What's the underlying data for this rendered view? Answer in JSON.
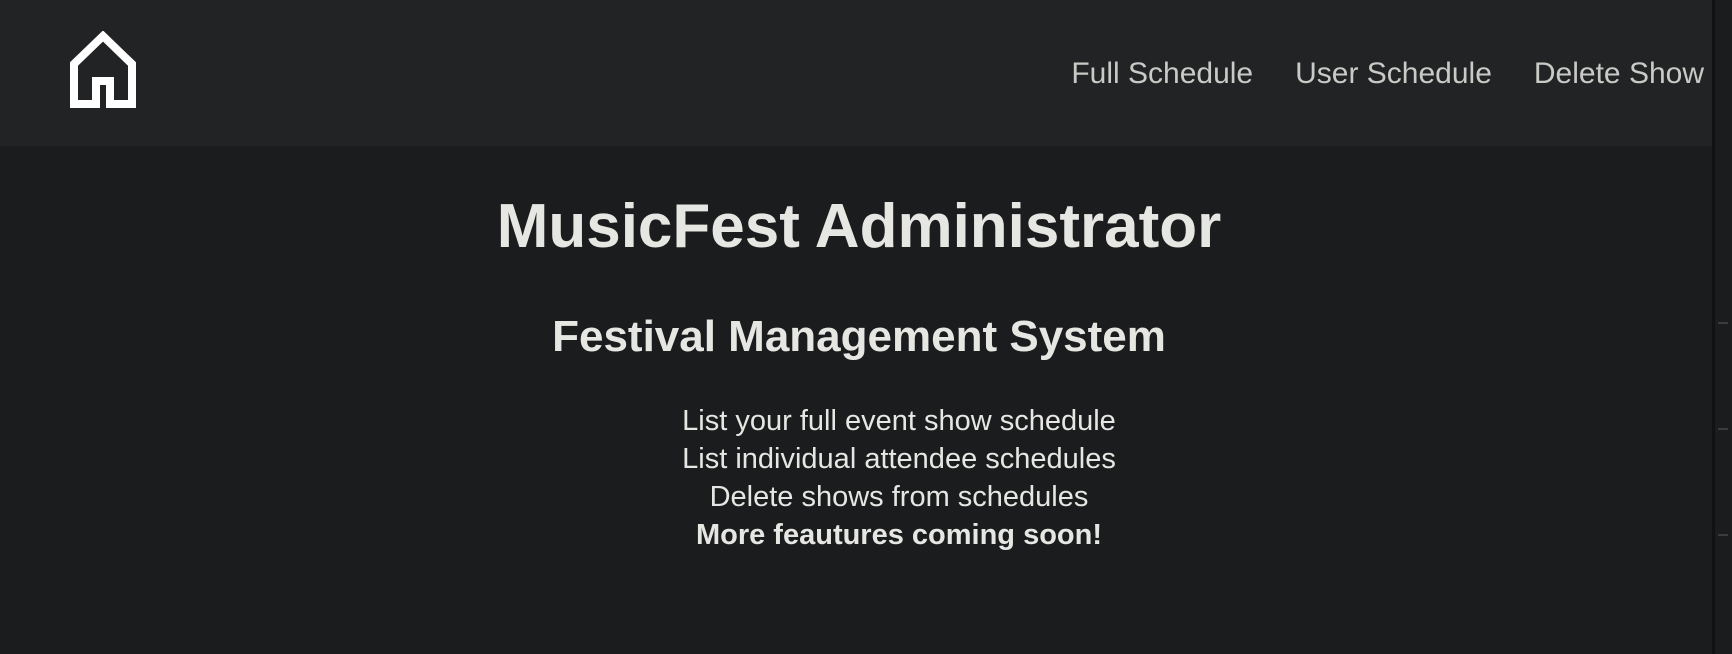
{
  "nav": {
    "home_icon": "house-icon",
    "links": [
      {
        "label": "Full Schedule"
      },
      {
        "label": "User Schedule"
      },
      {
        "label": "Delete Show"
      }
    ]
  },
  "main": {
    "title": "MusicFest Administrator",
    "subtitle": "Festival Management System",
    "features": [
      "List your full event show schedule",
      "List individual attendee schedules",
      "Delete shows from schedules"
    ],
    "announcement": "More feautures coming soon!"
  },
  "colors": {
    "page_background": "#1b1c1e",
    "navbar_background": "#222325",
    "nav_text": "#c9c9c6",
    "body_text": "#e6e6e3"
  }
}
